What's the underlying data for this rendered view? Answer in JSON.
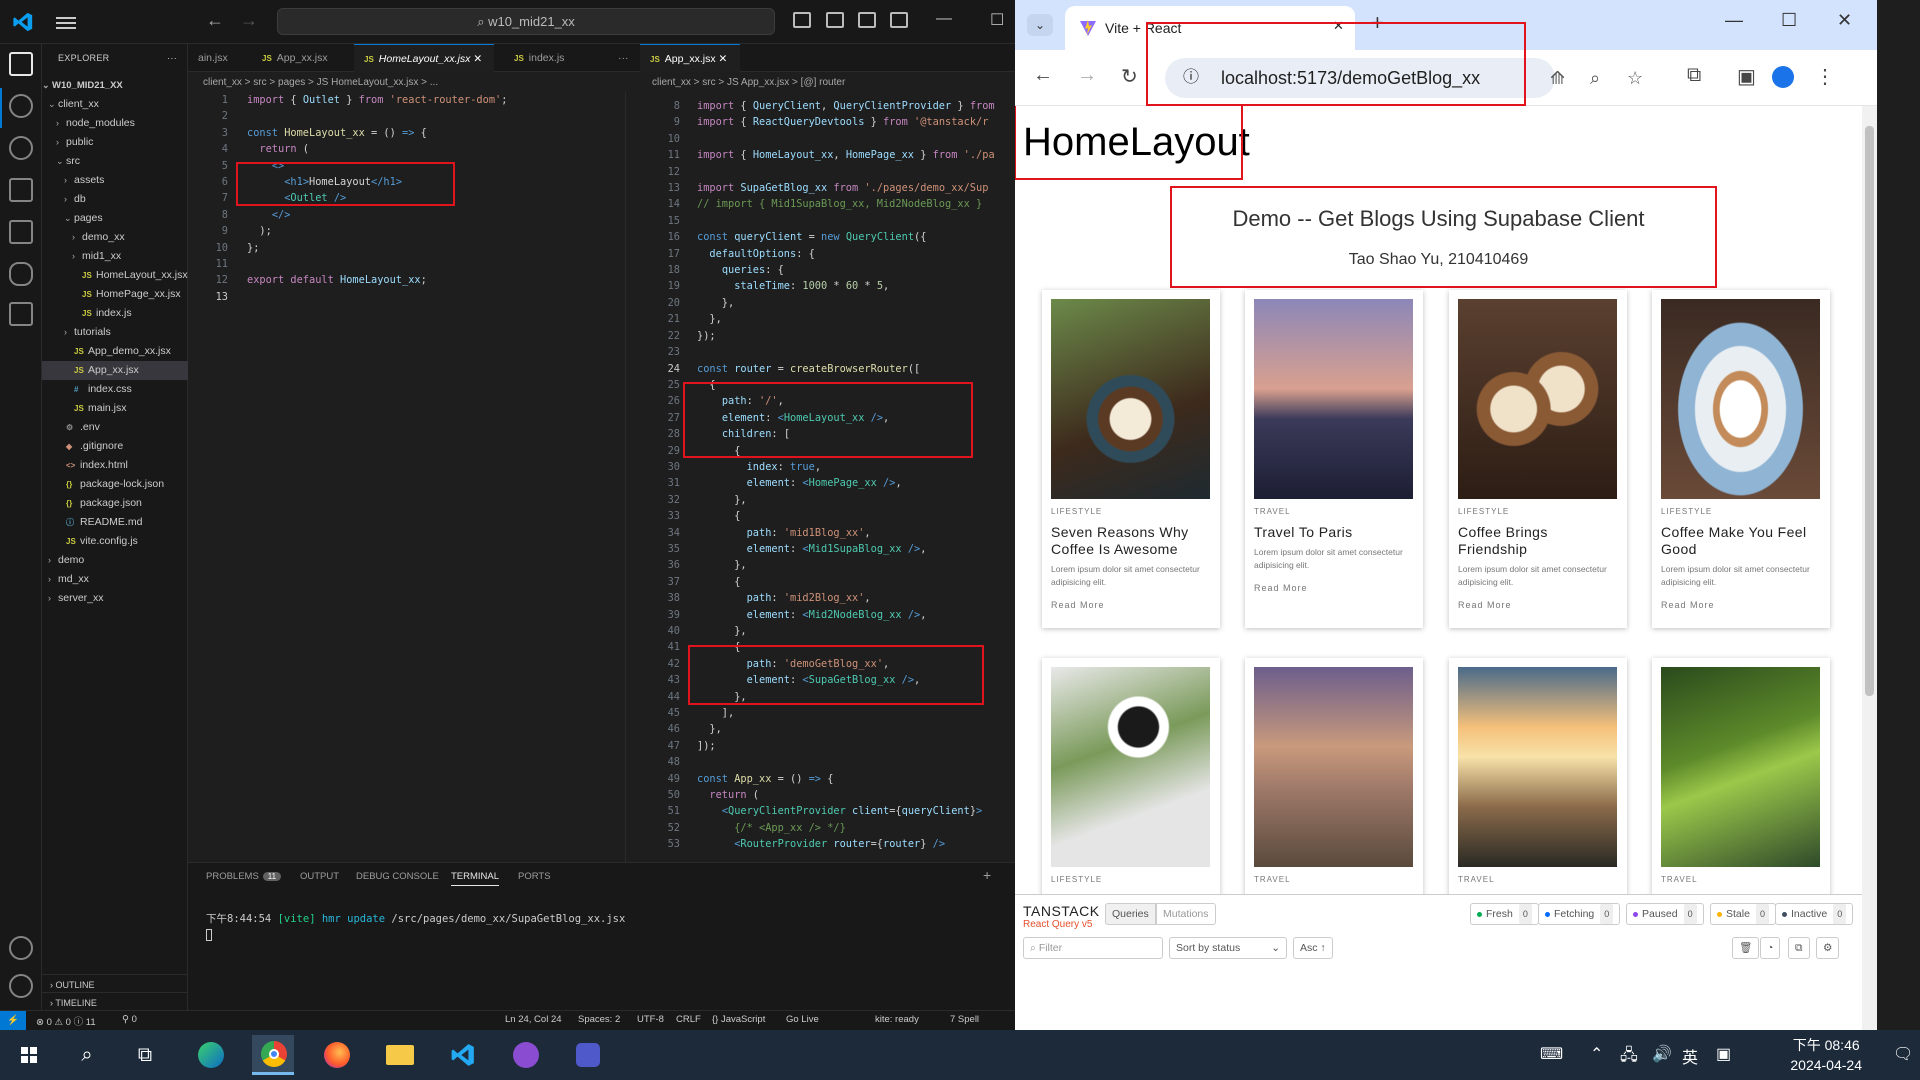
{
  "vscode": {
    "search": "w10_mid21_xx",
    "explorer": {
      "title": "EXPLORER",
      "root": "W10_MID21_XX",
      "items": [
        {
          "label": "client_xx",
          "kind": "folder-open",
          "depth": 0
        },
        {
          "label": "node_modules",
          "kind": "folder",
          "depth": 1
        },
        {
          "label": "public",
          "kind": "folder",
          "depth": 1
        },
        {
          "label": "src",
          "kind": "folder-open",
          "depth": 1
        },
        {
          "label": "assets",
          "kind": "folder",
          "depth": 2
        },
        {
          "label": "db",
          "kind": "folder",
          "depth": 2
        },
        {
          "label": "pages",
          "kind": "folder-open",
          "depth": 2
        },
        {
          "label": "demo_xx",
          "kind": "folder",
          "depth": 3
        },
        {
          "label": "mid1_xx",
          "kind": "folder",
          "depth": 3
        },
        {
          "label": "HomeLayout_xx.jsx",
          "kind": "js",
          "depth": 3
        },
        {
          "label": "HomePage_xx.jsx",
          "kind": "js",
          "depth": 3
        },
        {
          "label": "index.js",
          "kind": "js",
          "depth": 3
        },
        {
          "label": "tutorials",
          "kind": "folder",
          "depth": 2
        },
        {
          "label": "App_demo_xx.jsx",
          "kind": "js",
          "depth": 2
        },
        {
          "label": "App_xx.jsx",
          "kind": "js",
          "depth": 2,
          "selected": true
        },
        {
          "label": "index.css",
          "kind": "css",
          "depth": 2
        },
        {
          "label": "main.jsx",
          "kind": "js",
          "depth": 2
        },
        {
          "label": ".env",
          "kind": "gear",
          "depth": 1
        },
        {
          "label": ".gitignore",
          "kind": "git",
          "depth": 1
        },
        {
          "label": "index.html",
          "kind": "html",
          "depth": 1
        },
        {
          "label": "package-lock.json",
          "kind": "json",
          "depth": 1
        },
        {
          "label": "package.json",
          "kind": "json",
          "depth": 1
        },
        {
          "label": "README.md",
          "kind": "info",
          "depth": 1
        },
        {
          "label": "vite.config.js",
          "kind": "js",
          "depth": 1
        },
        {
          "label": "demo",
          "kind": "folder",
          "depth": 0
        },
        {
          "label": "md_xx",
          "kind": "folder",
          "depth": 0
        },
        {
          "label": "server_xx",
          "kind": "folder",
          "depth": 0
        }
      ],
      "outline": "OUTLINE",
      "timeline": "TIMELINE"
    },
    "left_tabs": [
      "ain.jsx",
      "App_xx.jsx",
      "HomeLayout_xx.jsx",
      "index.js"
    ],
    "left_breadcrumb": "client_xx > src > pages > JS HomeLayout_xx.jsx > ...",
    "left_lines": [
      "1",
      "2",
      "3",
      "4",
      "5",
      "6",
      "7",
      "8",
      "9",
      "10",
      "11",
      "12",
      "13"
    ],
    "right_tab": "App_xx.jsx",
    "right_breadcrumb": "client_xx > src > JS App_xx.jsx > [@] router",
    "right_lines": [
      "8",
      "9",
      "10",
      "11",
      "12",
      "13",
      "14",
      "15",
      "16",
      "17",
      "18",
      "19",
      "20",
      "21",
      "22",
      "23",
      "24",
      "25",
      "26",
      "27",
      "28",
      "29",
      "30",
      "31",
      "32",
      "33",
      "34",
      "35",
      "36",
      "37",
      "38",
      "39",
      "40",
      "41",
      "42",
      "43",
      "44",
      "45",
      "46",
      "47",
      "48",
      "49",
      "50",
      "51",
      "52",
      "53"
    ],
    "panel": {
      "tabs": [
        "PROBLEMS",
        "OUTPUT",
        "DEBUG CONSOLE",
        "TERMINAL",
        "PORTS"
      ],
      "problems_count": "11",
      "terminal_time": "下午8:44:54",
      "terminal_vite": "[vite]",
      "terminal_hmr": "hmr update",
      "terminal_path": "/src/pages/demo_xx/SupaGetBlog_xx.jsx"
    },
    "status": {
      "errors": "⊗ 0 ⚠ 0 ⓘ 11",
      "ports": "⚲ 0",
      "position": "Ln 24, Col 24",
      "spaces": "Spaces: 2",
      "encoding": "UTF-8",
      "eol": "CRLF",
      "language": "{} JavaScript",
      "golive": "Go Live",
      "kite": "kite: ready",
      "spell": "7 Spell"
    }
  },
  "browser": {
    "tab_title": "Vite + React",
    "url": "localhost:5173/demoGetBlog_xx",
    "page": {
      "layout_title": "HomeLayout",
      "heading": "Demo -- Get Blogs Using Supabase Client",
      "author": "Tao Shao Yu, 210410469",
      "cards": [
        {
          "category": "LIFESTYLE",
          "title": "Seven Reasons Why Coffee Is Awesome",
          "excerpt": "Lorem ipsum dolor sit amet consectetur adipisicing elit.",
          "read": "Read More",
          "image": "coffee-cups-photo"
        },
        {
          "category": "TRAVEL",
          "title": "Travel To Paris",
          "excerpt": "Lorem ipsum dolor sit amet consectetur adipisicing elit.",
          "read": "Read More",
          "image": "paris-bridge-photo"
        },
        {
          "category": "LIFESTYLE",
          "title": "Coffee Brings Friendship",
          "excerpt": "Lorem ipsum dolor sit amet consectetur adipisicing elit.",
          "read": "Read More",
          "image": "latte-cheers-photo"
        },
        {
          "category": "LIFESTYLE",
          "title": "Coffee Make You Feel Good",
          "excerpt": "Lorem ipsum dolor sit amet consectetur adipisicing elit.",
          "read": "Read More",
          "image": "blue-cup-photo"
        },
        {
          "category": "LIFESTYLE",
          "image": "coffee-plants-photo"
        },
        {
          "category": "TRAVEL",
          "image": "taipei-101-photo"
        },
        {
          "category": "TRAVEL",
          "image": "sunset-clouds-photo"
        },
        {
          "category": "TRAVEL",
          "image": "green-river-photo"
        }
      ]
    },
    "devtools": {
      "brand": "TANSTACK",
      "sub": "React Query v5",
      "tabs": [
        "Queries",
        "Mutations"
      ],
      "filters": [
        {
          "label": "Fresh",
          "count": "0",
          "color": "#00ab52"
        },
        {
          "label": "Fetching",
          "count": "0",
          "color": "#006bff"
        },
        {
          "label": "Paused",
          "count": "0",
          "color": "#8c49eb"
        },
        {
          "label": "Stale",
          "count": "0",
          "color": "#ffb200"
        },
        {
          "label": "Inactive",
          "count": "0",
          "color": "#3f4e60"
        }
      ],
      "filter_placeholder": "Filter",
      "sort": "Sort by status",
      "order": "Asc ↑"
    }
  },
  "taskbar": {
    "time": "下午 08:46",
    "date": "2024-04-24",
    "ime": "英",
    "apps": [
      "windows-start-icon",
      "search-icon",
      "task-view-icon",
      "edge-icon",
      "chrome-icon",
      "firefox-icon",
      "file-explorer-icon",
      "vscode-icon",
      "github-desktop-icon",
      "teams-icon"
    ]
  }
}
